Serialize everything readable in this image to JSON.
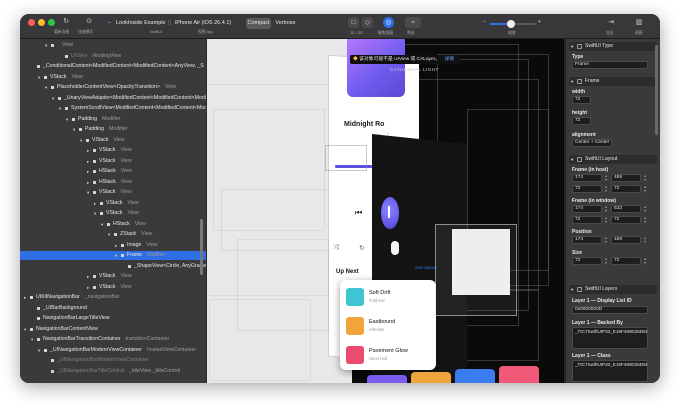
{
  "window": {
    "colors": {
      "close": "#ff5f57",
      "minimize": "#febc2e",
      "zoom": "#28c840",
      "accent": "#2e6fe5"
    }
  },
  "toolbar": {
    "reload_label": "重新连接",
    "scan_label": "快速模式",
    "app_name": "LookInside Example",
    "app_sub": "SwiftUI",
    "device_name": "iPhone Air (iOS 26.4.1)",
    "device_sub": "视图 App",
    "compact_label": "Compact",
    "verbose_label": "Verbose",
    "mode_label": "2D / 3D",
    "focus_label": "聚焦视图",
    "filter_label": "筛选",
    "zoom_label": "缩放",
    "zoom_minus": "−",
    "zoom_plus": "+",
    "zoom_level": 0.45,
    "share_label": "导出",
    "sidebar_toggle_label": "视图"
  },
  "hierarchy": [
    {
      "depth": 3,
      "arrow": "▾",
      "name": "",
      "sub": "View",
      "dim": true
    },
    {
      "depth": 5,
      "arrow": "",
      "name": "UIView",
      "sub": "HostingView",
      "dim": true
    },
    {
      "depth": 1,
      "arrow": "",
      "name": "_ConditionalContent<ModifiedContent<ModifiedContent<AnyView, _S",
      "sub": ""
    },
    {
      "depth": 2,
      "arrow": "▾",
      "name": "VStack",
      "sub": "View"
    },
    {
      "depth": 3,
      "arrow": "▾",
      "name": "PlaceholderContentView<OpacityTransition>",
      "sub": "View"
    },
    {
      "depth": 4,
      "arrow": "▾",
      "name": "_UnaryViewAdaptor<ModifiedContent<ModifiedContent<Modifiec",
      "sub": ""
    },
    {
      "depth": 5,
      "arrow": "▾",
      "name": "SystemScrollView<ModifiedContent<ModifiedContent<Modifiec",
      "sub": ""
    },
    {
      "depth": 6,
      "arrow": "▾",
      "name": "Padding",
      "sub": "Modifier"
    },
    {
      "depth": 7,
      "arrow": "▾",
      "name": "Padding",
      "sub": "Modifier"
    },
    {
      "depth": 8,
      "arrow": "▾",
      "name": "VStack",
      "sub": "View"
    },
    {
      "depth": 9,
      "arrow": "▸",
      "name": "VStack",
      "sub": "View"
    },
    {
      "depth": 9,
      "arrow": "▸",
      "name": "VStack",
      "sub": "View"
    },
    {
      "depth": 9,
      "arrow": "▸",
      "name": "HStack",
      "sub": "View"
    },
    {
      "depth": 9,
      "arrow": "▸",
      "name": "HStack",
      "sub": "View"
    },
    {
      "depth": 9,
      "arrow": "▾",
      "name": "VStack",
      "sub": "View"
    },
    {
      "depth": 10,
      "arrow": "▸",
      "name": "VStack",
      "sub": "View"
    },
    {
      "depth": 10,
      "arrow": "▾",
      "name": "VStack",
      "sub": "View"
    },
    {
      "depth": 11,
      "arrow": "▾",
      "name": "HStack",
      "sub": "View"
    },
    {
      "depth": 12,
      "arrow": "▾",
      "name": "ZStack",
      "sub": "View"
    },
    {
      "depth": 13,
      "arrow": "▸",
      "name": "Image",
      "sub": "View"
    },
    {
      "depth": 13,
      "arrow": "▾",
      "name": "Frame",
      "sub": "Modifier",
      "selected": true
    },
    {
      "depth": 14,
      "arrow": "",
      "name": "_ShapeView<Circle, AnyGradient>",
      "sub": "View"
    },
    {
      "depth": 9,
      "arrow": "▸",
      "name": "VStack",
      "sub": "View"
    },
    {
      "depth": 9,
      "arrow": "▸",
      "name": "VStack",
      "sub": "View"
    },
    {
      "depth": 0,
      "arrow": "▸",
      "name": "UIKitNavigationBar",
      "sub": "_navigationBar"
    },
    {
      "depth": 1,
      "arrow": "",
      "name": "_UIBarBackground",
      "sub": ""
    },
    {
      "depth": 1,
      "arrow": "",
      "name": "NavigationBarLargeTitleView",
      "sub": ""
    },
    {
      "depth": 0,
      "arrow": "▾",
      "name": "NavigationBarContentView",
      "sub": ""
    },
    {
      "depth": 1,
      "arrow": "▾",
      "name": "NavigationBarTransitionContainer",
      "sub": "transitionContainer"
    },
    {
      "depth": 2,
      "arrow": "▾",
      "name": "_UINavigationBarModernViewContainer",
      "sub": "hostedViewContainer"
    },
    {
      "depth": 3,
      "arrow": "",
      "name": "_UINavigationBarModernViewContainer",
      "sub": "",
      "dim": true
    },
    {
      "depth": 3,
      "arrow": "",
      "name": "_UINavigationBarTitleControl",
      "sub": "_titleView _titleControl",
      "dim": true
    }
  ],
  "sidebar_footer": {
    "filter_label": "筛选"
  },
  "canvas": {
    "tooltip": "该对象可能不是 UIView 或 CALayer。",
    "tooltip_action": "详情",
    "cathedral_label": "CATHEDRAL LIGHT",
    "track_title": "Midnight Ro",
    "up_next": "Up Next",
    "see_queue": "See queue",
    "queue": [
      {
        "title": "Soft Drift",
        "sub": "Fold Mix",
        "color": "#3fc5d2"
      },
      {
        "title": "Eastbound",
        "sub": "Afterline",
        "color": "#f2a43c"
      },
      {
        "title": "Pavement Glow",
        "sub": "Neon Hall",
        "color": "#ea4b6e"
      }
    ],
    "bottom_cards": [
      "#7b5cf0",
      "#f2a43c",
      "#3a7cf0",
      "#f05a78"
    ],
    "controls": {
      "shuffle": "⤨",
      "prev": "⏮",
      "repeat": "↻"
    }
  },
  "inspector": {
    "type_section": {
      "title": "SwiftUI Type",
      "type_label": "Type",
      "type_value": "Frame"
    },
    "frame_section": {
      "title": "Frame",
      "width_label": "width",
      "width_value": "72",
      "height_label": "height",
      "height_value": "72",
      "alignment_label": "alignment",
      "alignment_value": "Center + Center"
    },
    "layout_section": {
      "title": "SwiftUI Layout",
      "host_label": "Frame (in host)",
      "host": [
        "174",
        "459",
        "72",
        "72"
      ],
      "window_label": "Frame (in window)",
      "window": [
        "174",
        "633",
        "72",
        "72"
      ],
      "position_label": "Position",
      "position": [
        "174",
        "459"
      ],
      "size_label": "Size",
      "size": [
        "72",
        "72"
      ]
    },
    "layers_section": {
      "title": "SwiftUI Layers",
      "display_label": "Layer 1 — Display List ID",
      "display_value": "0x0000000D",
      "backed_label": "Layer 1 — Backed By",
      "backed_value": "_TtC7SwiftUIP33_E19F490D25D5E5ECBA24903AF958E3412DUnclippedGradientLayer",
      "class_label": "Layer 1 — Class",
      "class_value": "_TtC7SwiftUIP33_E19F490D25D5E5ECBA24903AF958E3412DUnclippedGradientLayer"
    }
  }
}
